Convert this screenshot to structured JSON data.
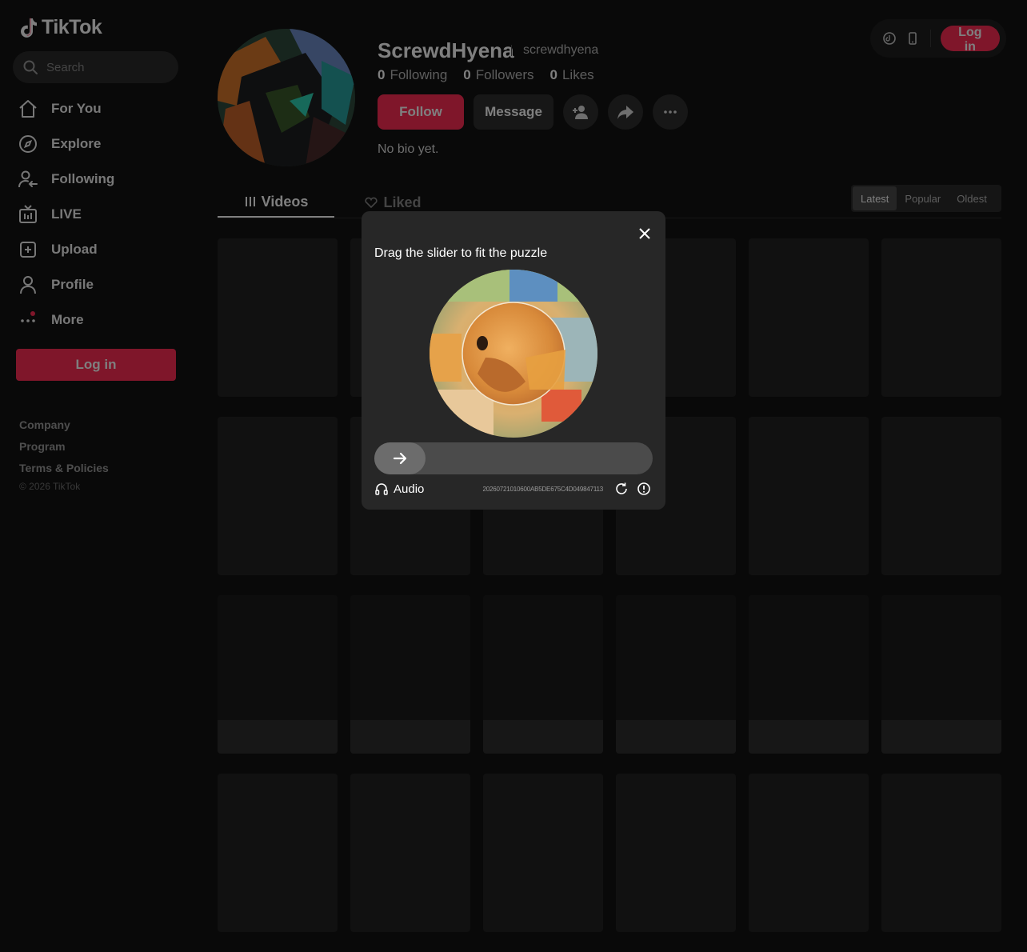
{
  "app": {
    "brand": "TikTok",
    "accent": "#fe2c55"
  },
  "search": {
    "placeholder": "Search"
  },
  "nav": {
    "items": [
      {
        "label": "For You",
        "icon": "home-icon"
      },
      {
        "label": "Explore",
        "icon": "compass-icon"
      },
      {
        "label": "Following",
        "icon": "following-icon"
      },
      {
        "label": "LIVE",
        "icon": "live-icon"
      },
      {
        "label": "Upload",
        "icon": "upload-icon"
      },
      {
        "label": "Profile",
        "icon": "profile-icon"
      },
      {
        "label": "More",
        "icon": "more-icon"
      }
    ]
  },
  "sidebar": {
    "login_label": "Log in"
  },
  "footer": {
    "links": [
      "Company",
      "Program",
      "Terms & Policies"
    ],
    "copyright": "© 2026 TikTok"
  },
  "topbar": {
    "login_label": "Log in"
  },
  "profile": {
    "display_name": "ScrewdHyena",
    "handle": "screwdhyena",
    "following_count": "0",
    "following_label": "Following",
    "followers_count": "0",
    "followers_label": "Followers",
    "likes_count": "0",
    "likes_label": "Likes",
    "follow_label": "Follow",
    "message_label": "Message",
    "bio": "No bio yet."
  },
  "tabs": [
    {
      "label": "Videos",
      "active": true
    },
    {
      "label": "Liked",
      "active": false
    }
  ],
  "sort": [
    {
      "label": "Latest",
      "active": true
    },
    {
      "label": "Popular",
      "active": false
    },
    {
      "label": "Oldest",
      "active": false
    }
  ],
  "captcha": {
    "title": "Drag the slider to fit the puzzle",
    "audio_label": "Audio",
    "code": "20260721010600AB5DE675C4D049847113",
    "slider_progress": 0
  }
}
